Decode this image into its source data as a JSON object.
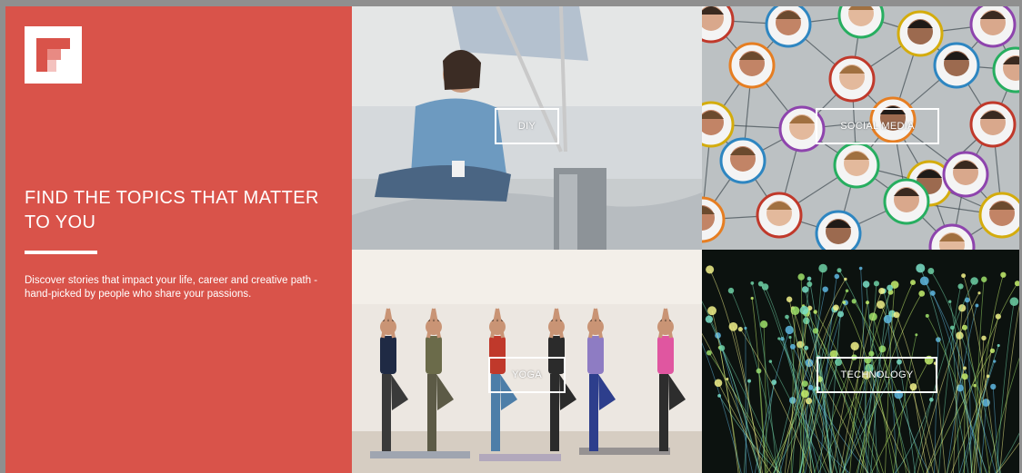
{
  "brand": {
    "logo_icon": "flipboard-logo-icon",
    "accent_color": "#d9534a"
  },
  "hero": {
    "headline": "FIND THE TOPICS THAT MATTER TO YOU",
    "description": "Discover stories that impact your life, career and creative path - hand-picked by people who share your passions."
  },
  "topics": [
    {
      "label": "DIY"
    },
    {
      "label": "SOCIAL MEDIA"
    },
    {
      "label": "YOGA"
    },
    {
      "label": "TECHNOLOGY"
    }
  ]
}
